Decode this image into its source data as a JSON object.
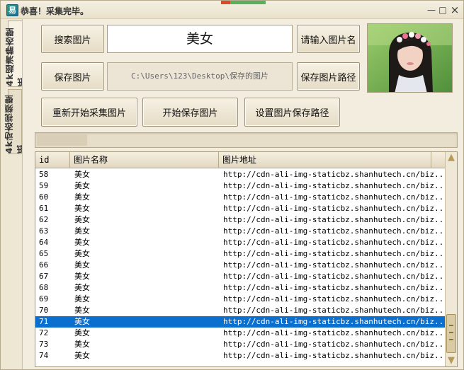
{
  "window": {
    "title": "恭喜！采集完毕。",
    "minimize": "—",
    "maximize": "□",
    "close": "×"
  },
  "tabs": [
    {
      "label": "4k超清静态壁纸",
      "active": true
    },
    {
      "label": "4k动态视频壁纸",
      "active": false
    }
  ],
  "controls": {
    "search_button": "搜索图片",
    "keyword_value": "美女",
    "enter_name_button": "请输入图片名",
    "save_button": "保存图片",
    "save_path_value": "C:\\Users\\123\\Desktop\\保存的图片",
    "save_path_button": "保存图片路径",
    "restart_button": "重新开始采集图片",
    "start_save_button": "开始保存图片",
    "set_path_button": "设置图片保存路径"
  },
  "progress": 0.12,
  "list": {
    "columns": [
      "id",
      "图片名称",
      "图片地址"
    ],
    "rows": [
      {
        "id": "58",
        "name": "美女",
        "url": "http://cdn-ali-img-staticbz.shanhutech.cn/biz..."
      },
      {
        "id": "59",
        "name": "美女",
        "url": "http://cdn-ali-img-staticbz.shanhutech.cn/biz..."
      },
      {
        "id": "60",
        "name": "美女",
        "url": "http://cdn-ali-img-staticbz.shanhutech.cn/biz..."
      },
      {
        "id": "61",
        "name": "美女",
        "url": "http://cdn-ali-img-staticbz.shanhutech.cn/biz..."
      },
      {
        "id": "62",
        "name": "美女",
        "url": "http://cdn-ali-img-staticbz.shanhutech.cn/biz..."
      },
      {
        "id": "63",
        "name": "美女",
        "url": "http://cdn-ali-img-staticbz.shanhutech.cn/biz..."
      },
      {
        "id": "64",
        "name": "美女",
        "url": "http://cdn-ali-img-staticbz.shanhutech.cn/biz..."
      },
      {
        "id": "65",
        "name": "美女",
        "url": "http://cdn-ali-img-staticbz.shanhutech.cn/biz..."
      },
      {
        "id": "66",
        "name": "美女",
        "url": "http://cdn-ali-img-staticbz.shanhutech.cn/biz..."
      },
      {
        "id": "67",
        "name": "美女",
        "url": "http://cdn-ali-img-staticbz.shanhutech.cn/biz..."
      },
      {
        "id": "68",
        "name": "美女",
        "url": "http://cdn-ali-img-staticbz.shanhutech.cn/biz..."
      },
      {
        "id": "69",
        "name": "美女",
        "url": "http://cdn-ali-img-staticbz.shanhutech.cn/biz..."
      },
      {
        "id": "70",
        "name": "美女",
        "url": "http://cdn-ali-img-staticbz.shanhutech.cn/biz..."
      },
      {
        "id": "71",
        "name": "美女",
        "url": "http://cdn-ali-img-staticbz.shanhutech.cn/biz...",
        "selected": true
      },
      {
        "id": "72",
        "name": "美女",
        "url": "http://cdn-ali-img-staticbz.shanhutech.cn/biz..."
      },
      {
        "id": "73",
        "name": "美女",
        "url": "http://cdn-ali-img-staticbz.shanhutech.cn/biz..."
      },
      {
        "id": "74",
        "name": "美女",
        "url": "http://cdn-ali-img-staticbz.shanhutech.cn/biz..."
      }
    ]
  },
  "scrollbar": {
    "up_icon": "▲",
    "down_icon": "▼"
  },
  "colors": {
    "selection": "#0b6fd0",
    "accent_red": "#d84a2a",
    "accent_green": "#57b05a"
  }
}
